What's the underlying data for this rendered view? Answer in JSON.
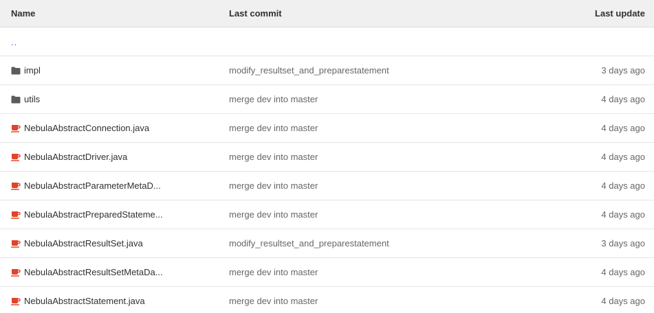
{
  "header": {
    "name": "Name",
    "last_commit": "Last commit",
    "last_update": "Last update"
  },
  "parent": "..",
  "rows": [
    {
      "name": "impl",
      "type": "folder",
      "icon": "folder-icon",
      "commit": "modify_resultset_and_preparestatement",
      "updated": "3 days ago"
    },
    {
      "name": "utils",
      "type": "folder",
      "icon": "folder-icon",
      "commit": "merge dev into master",
      "updated": "4 days ago"
    },
    {
      "name": "NebulaAbstractConnection.java",
      "type": "file",
      "icon": "java-icon",
      "commit": "merge dev into master",
      "updated": "4 days ago"
    },
    {
      "name": "NebulaAbstractDriver.java",
      "type": "file",
      "icon": "java-icon",
      "commit": "merge dev into master",
      "updated": "4 days ago"
    },
    {
      "name": "NebulaAbstractParameterMetaD...",
      "type": "file",
      "icon": "java-icon",
      "commit": "merge dev into master",
      "updated": "4 days ago"
    },
    {
      "name": "NebulaAbstractPreparedStateme...",
      "type": "file",
      "icon": "java-icon",
      "commit": "merge dev into master",
      "updated": "4 days ago"
    },
    {
      "name": "NebulaAbstractResultSet.java",
      "type": "file",
      "icon": "java-icon",
      "commit": "modify_resultset_and_preparestatement",
      "updated": "3 days ago"
    },
    {
      "name": "NebulaAbstractResultSetMetaDa...",
      "type": "file",
      "icon": "java-icon",
      "commit": "merge dev into master",
      "updated": "4 days ago"
    },
    {
      "name": "NebulaAbstractStatement.java",
      "type": "file",
      "icon": "java-icon",
      "commit": "merge dev into master",
      "updated": "4 days ago"
    }
  ],
  "colors": {
    "folder": "#5c5c5c",
    "java": "#e24329",
    "link": "#1f78d1",
    "header_bg": "#f0f0f0"
  }
}
